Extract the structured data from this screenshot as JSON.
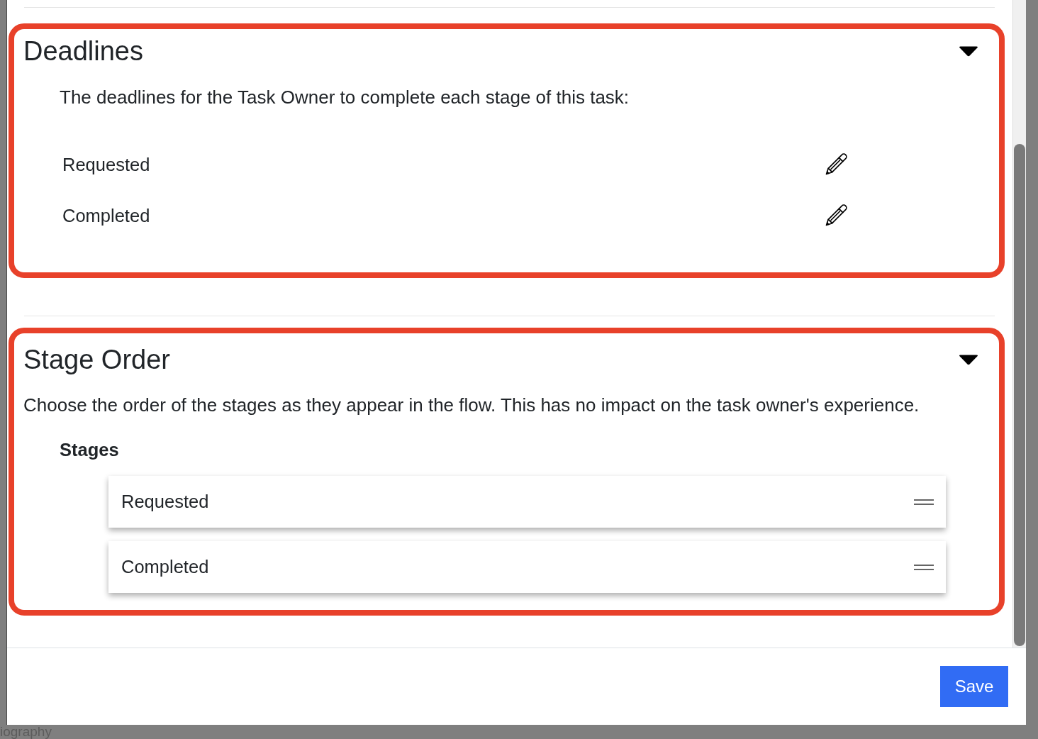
{
  "background": {
    "text": "iography"
  },
  "dialog": {
    "sections": [
      {
        "kind": "deadlines",
        "title": "Deadlines",
        "expanded": true,
        "highlighted": true,
        "description": "The deadlines for the Task Owner to complete each stage of this task:",
        "rows": [
          {
            "label": "Requested"
          },
          {
            "label": "Completed"
          }
        ]
      },
      {
        "kind": "stage_order",
        "title": "Stage Order",
        "expanded": true,
        "highlighted": true,
        "description": "Choose the order of the stages as they appear in the flow. This has no impact on the task owner's experience.",
        "list_label": "Stages",
        "stages": [
          {
            "label": "Requested"
          },
          {
            "label": "Completed"
          }
        ]
      }
    ],
    "save_button": "Save"
  }
}
